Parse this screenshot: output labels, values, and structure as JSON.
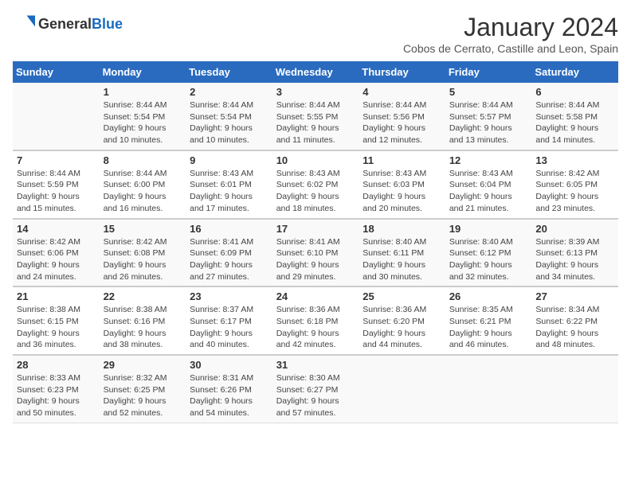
{
  "header": {
    "logo_general": "General",
    "logo_blue": "Blue",
    "title": "January 2024",
    "location": "Cobos de Cerrato, Castille and Leon, Spain"
  },
  "weekdays": [
    "Sunday",
    "Monday",
    "Tuesday",
    "Wednesday",
    "Thursday",
    "Friday",
    "Saturday"
  ],
  "weeks": [
    [
      {
        "day": "",
        "sunrise": "",
        "sunset": "",
        "daylight": ""
      },
      {
        "day": "1",
        "sunrise": "Sunrise: 8:44 AM",
        "sunset": "Sunset: 5:54 PM",
        "daylight": "Daylight: 9 hours and 10 minutes."
      },
      {
        "day": "2",
        "sunrise": "Sunrise: 8:44 AM",
        "sunset": "Sunset: 5:54 PM",
        "daylight": "Daylight: 9 hours and 10 minutes."
      },
      {
        "day": "3",
        "sunrise": "Sunrise: 8:44 AM",
        "sunset": "Sunset: 5:55 PM",
        "daylight": "Daylight: 9 hours and 11 minutes."
      },
      {
        "day": "4",
        "sunrise": "Sunrise: 8:44 AM",
        "sunset": "Sunset: 5:56 PM",
        "daylight": "Daylight: 9 hours and 12 minutes."
      },
      {
        "day": "5",
        "sunrise": "Sunrise: 8:44 AM",
        "sunset": "Sunset: 5:57 PM",
        "daylight": "Daylight: 9 hours and 13 minutes."
      },
      {
        "day": "6",
        "sunrise": "Sunrise: 8:44 AM",
        "sunset": "Sunset: 5:58 PM",
        "daylight": "Daylight: 9 hours and 14 minutes."
      }
    ],
    [
      {
        "day": "7",
        "sunrise": "Sunrise: 8:44 AM",
        "sunset": "Sunset: 5:59 PM",
        "daylight": "Daylight: 9 hours and 15 minutes."
      },
      {
        "day": "8",
        "sunrise": "Sunrise: 8:44 AM",
        "sunset": "Sunset: 6:00 PM",
        "daylight": "Daylight: 9 hours and 16 minutes."
      },
      {
        "day": "9",
        "sunrise": "Sunrise: 8:43 AM",
        "sunset": "Sunset: 6:01 PM",
        "daylight": "Daylight: 9 hours and 17 minutes."
      },
      {
        "day": "10",
        "sunrise": "Sunrise: 8:43 AM",
        "sunset": "Sunset: 6:02 PM",
        "daylight": "Daylight: 9 hours and 18 minutes."
      },
      {
        "day": "11",
        "sunrise": "Sunrise: 8:43 AM",
        "sunset": "Sunset: 6:03 PM",
        "daylight": "Daylight: 9 hours and 20 minutes."
      },
      {
        "day": "12",
        "sunrise": "Sunrise: 8:43 AM",
        "sunset": "Sunset: 6:04 PM",
        "daylight": "Daylight: 9 hours and 21 minutes."
      },
      {
        "day": "13",
        "sunrise": "Sunrise: 8:42 AM",
        "sunset": "Sunset: 6:05 PM",
        "daylight": "Daylight: 9 hours and 23 minutes."
      }
    ],
    [
      {
        "day": "14",
        "sunrise": "Sunrise: 8:42 AM",
        "sunset": "Sunset: 6:06 PM",
        "daylight": "Daylight: 9 hours and 24 minutes."
      },
      {
        "day": "15",
        "sunrise": "Sunrise: 8:42 AM",
        "sunset": "Sunset: 6:08 PM",
        "daylight": "Daylight: 9 hours and 26 minutes."
      },
      {
        "day": "16",
        "sunrise": "Sunrise: 8:41 AM",
        "sunset": "Sunset: 6:09 PM",
        "daylight": "Daylight: 9 hours and 27 minutes."
      },
      {
        "day": "17",
        "sunrise": "Sunrise: 8:41 AM",
        "sunset": "Sunset: 6:10 PM",
        "daylight": "Daylight: 9 hours and 29 minutes."
      },
      {
        "day": "18",
        "sunrise": "Sunrise: 8:40 AM",
        "sunset": "Sunset: 6:11 PM",
        "daylight": "Daylight: 9 hours and 30 minutes."
      },
      {
        "day": "19",
        "sunrise": "Sunrise: 8:40 AM",
        "sunset": "Sunset: 6:12 PM",
        "daylight": "Daylight: 9 hours and 32 minutes."
      },
      {
        "day": "20",
        "sunrise": "Sunrise: 8:39 AM",
        "sunset": "Sunset: 6:13 PM",
        "daylight": "Daylight: 9 hours and 34 minutes."
      }
    ],
    [
      {
        "day": "21",
        "sunrise": "Sunrise: 8:38 AM",
        "sunset": "Sunset: 6:15 PM",
        "daylight": "Daylight: 9 hours and 36 minutes."
      },
      {
        "day": "22",
        "sunrise": "Sunrise: 8:38 AM",
        "sunset": "Sunset: 6:16 PM",
        "daylight": "Daylight: 9 hours and 38 minutes."
      },
      {
        "day": "23",
        "sunrise": "Sunrise: 8:37 AM",
        "sunset": "Sunset: 6:17 PM",
        "daylight": "Daylight: 9 hours and 40 minutes."
      },
      {
        "day": "24",
        "sunrise": "Sunrise: 8:36 AM",
        "sunset": "Sunset: 6:18 PM",
        "daylight": "Daylight: 9 hours and 42 minutes."
      },
      {
        "day": "25",
        "sunrise": "Sunrise: 8:36 AM",
        "sunset": "Sunset: 6:20 PM",
        "daylight": "Daylight: 9 hours and 44 minutes."
      },
      {
        "day": "26",
        "sunrise": "Sunrise: 8:35 AM",
        "sunset": "Sunset: 6:21 PM",
        "daylight": "Daylight: 9 hours and 46 minutes."
      },
      {
        "day": "27",
        "sunrise": "Sunrise: 8:34 AM",
        "sunset": "Sunset: 6:22 PM",
        "daylight": "Daylight: 9 hours and 48 minutes."
      }
    ],
    [
      {
        "day": "28",
        "sunrise": "Sunrise: 8:33 AM",
        "sunset": "Sunset: 6:23 PM",
        "daylight": "Daylight: 9 hours and 50 minutes."
      },
      {
        "day": "29",
        "sunrise": "Sunrise: 8:32 AM",
        "sunset": "Sunset: 6:25 PM",
        "daylight": "Daylight: 9 hours and 52 minutes."
      },
      {
        "day": "30",
        "sunrise": "Sunrise: 8:31 AM",
        "sunset": "Sunset: 6:26 PM",
        "daylight": "Daylight: 9 hours and 54 minutes."
      },
      {
        "day": "31",
        "sunrise": "Sunrise: 8:30 AM",
        "sunset": "Sunset: 6:27 PM",
        "daylight": "Daylight: 9 hours and 57 minutes."
      },
      {
        "day": "",
        "sunrise": "",
        "sunset": "",
        "daylight": ""
      },
      {
        "day": "",
        "sunrise": "",
        "sunset": "",
        "daylight": ""
      },
      {
        "day": "",
        "sunrise": "",
        "sunset": "",
        "daylight": ""
      }
    ]
  ]
}
